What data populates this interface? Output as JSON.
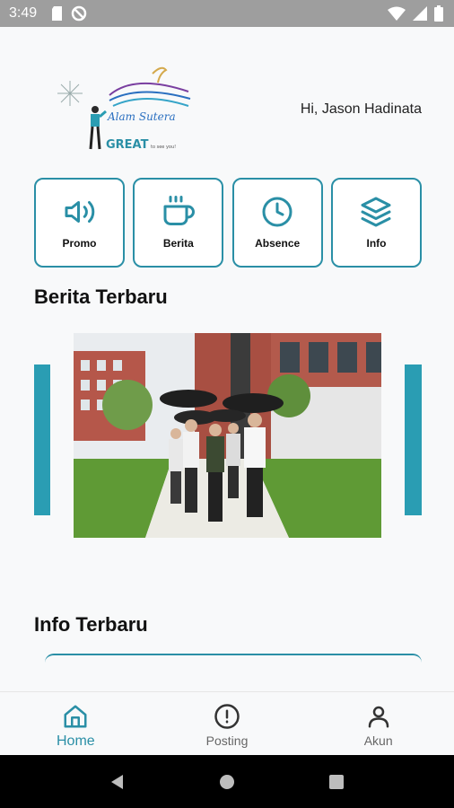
{
  "status_bar": {
    "time": "3:49"
  },
  "header": {
    "greeting": "Hi, Jason Hadinata",
    "logo_script": "Alam Sutera",
    "logo_great": "GREAT",
    "logo_tagline": "to see you!"
  },
  "menu": [
    {
      "label": "Promo",
      "icon": "speaker-icon"
    },
    {
      "label": "Berita",
      "icon": "coffee-cup-icon"
    },
    {
      "label": "Absence",
      "icon": "clock-icon"
    },
    {
      "label": "Info",
      "icon": "layers-icon"
    }
  ],
  "sections": {
    "news_title": "Berita Terbaru",
    "info_title": "Info Terbaru"
  },
  "bottom_nav": [
    {
      "label": "Home",
      "icon": "home-icon",
      "active": true
    },
    {
      "label": "Posting",
      "icon": "alert-circle-icon",
      "active": false
    },
    {
      "label": "Akun",
      "icon": "user-icon",
      "active": false
    }
  ],
  "colors": {
    "accent": "#2a8fa6",
    "status_bar": "#9e9e9e",
    "background": "#f8f9fa"
  }
}
